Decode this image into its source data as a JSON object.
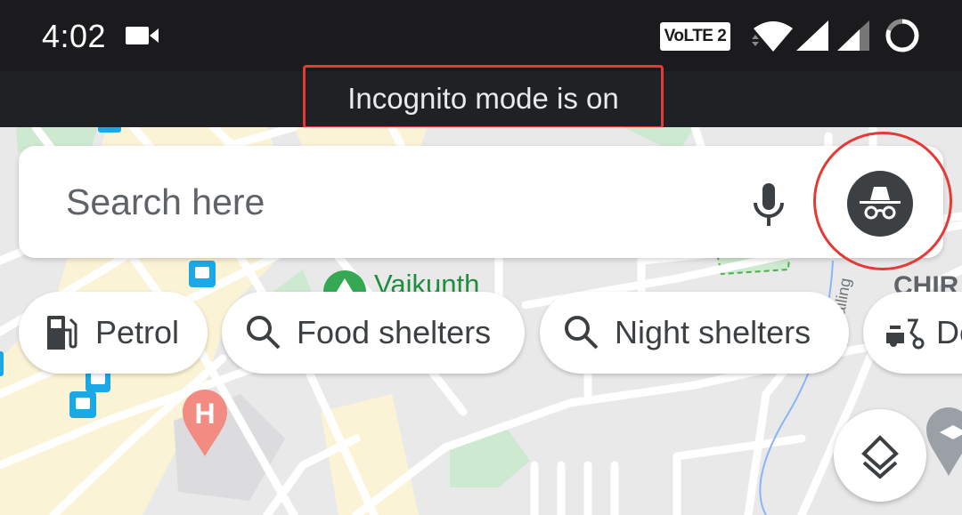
{
  "status_bar": {
    "time": "4:02",
    "volte_label": "VoLTE 2",
    "icons": [
      "video-camera-icon",
      "volte-icon",
      "wifi-icon",
      "signal-sim1-icon",
      "signal-sim2-icon",
      "battery-ring-icon"
    ]
  },
  "banner": {
    "text": "Incognito mode is on",
    "highlight_color": "#e53935"
  },
  "search": {
    "placeholder": "Search here",
    "value": "",
    "mic_icon": "microphone-icon",
    "account_icon": "incognito-icon"
  },
  "chips": [
    {
      "label": "Petrol",
      "icon": "fuel-pump-icon"
    },
    {
      "label": "Food shelters",
      "icon": "search-icon"
    },
    {
      "label": "Night shelters",
      "icon": "search-icon"
    },
    {
      "label": "De",
      "icon": "scooter-icon"
    }
  ],
  "map": {
    "labels": [
      {
        "text": "Vaikunth",
        "color": "#1e8e3e"
      },
      {
        "text": "CHIR",
        "color": "#5f6368"
      },
      {
        "text": "ailing",
        "color": "#70757a"
      }
    ],
    "pins": [
      "hospital-pin-icon",
      "school-pin-icon",
      "bus-stop-icon",
      "park-marker-icon"
    ],
    "layers_icon": "layers-icon"
  },
  "colors": {
    "hospital_pin": "#f28b82",
    "bus_stop": "#1aa9e6",
    "park_green": "#34a853",
    "chip_text": "#3c4043"
  }
}
